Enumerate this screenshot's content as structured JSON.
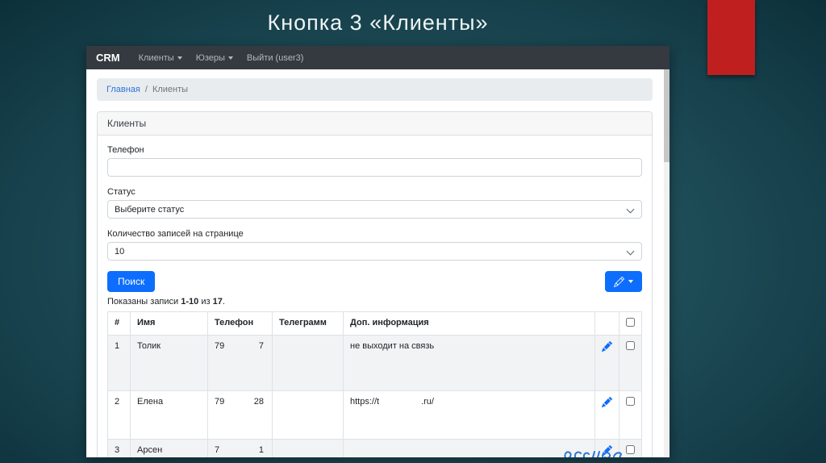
{
  "slide": {
    "title": "Кнопка 3 «Клиенты»"
  },
  "colors": {
    "primary_blue": "#0d6efd",
    "navbar_bg": "#343a40",
    "accent_red": "#bf1f1f",
    "slide_teal": "#1e4d57"
  },
  "navbar": {
    "brand": "CRM",
    "menu": [
      {
        "label": "Клиенты",
        "has_caret": true
      },
      {
        "label": "Юзеры",
        "has_caret": true
      },
      {
        "label": "Выйти (user3)",
        "has_caret": false
      }
    ]
  },
  "breadcrumb": {
    "home": "Главная",
    "separator": "/",
    "current": "Клиенты"
  },
  "panel_title": "Клиенты",
  "form": {
    "phone_label": "Телефон",
    "phone_value": "",
    "status_label": "Статус",
    "status_selected": "Выберите статус",
    "page_size_label": "Количество записей на странице",
    "page_size_selected": "10"
  },
  "toolbar": {
    "search_label": "Поиск"
  },
  "summary": {
    "text_before": "Показаны записи ",
    "range": "1-10",
    "text_mid": " из ",
    "total": "17",
    "text_after": "."
  },
  "table": {
    "headers": [
      "#",
      "Имя",
      "Телефон",
      "Телеграмм",
      "Доп. информация"
    ],
    "rows": [
      {
        "num": "1",
        "name": "Толик",
        "phone_start": "79",
        "phone_end": "7",
        "telegram": "",
        "info_start": "не выходит на связь",
        "info_end": ""
      },
      {
        "num": "2",
        "name": "Елена",
        "phone_start": "79",
        "phone_end": "28",
        "telegram": "",
        "info_start": "https://t",
        "info_end": ".ru/"
      },
      {
        "num": "3",
        "name": "Арсен",
        "phone_start": "7",
        "phone_end": "1",
        "telegram": "",
        "info_start": "",
        "info_end": ""
      }
    ]
  }
}
